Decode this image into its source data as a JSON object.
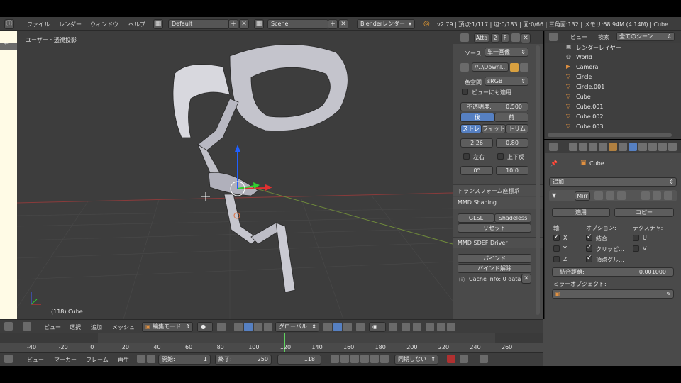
{
  "info_bar": {
    "menus": [
      "ファイル",
      "レンダー",
      "ウィンドウ",
      "ヘルプ"
    ],
    "layout": "Default",
    "scene": "Scene",
    "engine": "Blenderレンダー",
    "stats": "v2.79 | 頂点:1/117 | 辺:0/183 | 面:0/66 | 三角面:132 | メモリ:68.94M (4.14M) | Cube"
  },
  "viewport": {
    "view_label": "ユーザー・透視投影",
    "object_label": "(118) Cube"
  },
  "nprop": {
    "tabs": [
      "Atta",
      "2",
      "F"
    ],
    "source_label": "ソース",
    "source_value": "単一画像",
    "file_path": "//..\\Downl...",
    "colorspace_label": "色空間",
    "colorspace_value": "sRGB",
    "view_as_render": "ビューにも適用",
    "opacity_label": "不透明度:",
    "opacity_value": "0.500",
    "depth_back": "後",
    "depth_front": "前",
    "fit_stretch": "ストレ",
    "fit_fit": "フィット",
    "fit_crop": "トリム",
    "size_x": "2.26",
    "size_y": "0.80",
    "flip_x": "左右",
    "flip_y": "上下反",
    "rotation": "0°",
    "size": "10.0",
    "transform_panel": "トランスフォーム座標系",
    "mmd_shading": "MMD Shading",
    "glsl": "GLSL",
    "shadeless": "Shadeless",
    "reset": "リセット",
    "sdef_panel": "MMD SDEF Driver",
    "bind": "バインド",
    "unbind": "バインド解除",
    "cache_info": "Cache info: 0 data"
  },
  "outliner": {
    "view_menu": "ビュー",
    "search_menu": "検索",
    "filter": "全てのシーン",
    "items": [
      "レンダーレイヤー",
      "World",
      "Camera",
      "Circle",
      "Circle.001",
      "Cube",
      "Cube.001",
      "Cube.002",
      "Cube.003"
    ]
  },
  "properties": {
    "object_name": "Cube",
    "add_modifier": "追加",
    "modifier_name": "Mirr",
    "apply": "適用",
    "copy": "コピー",
    "axis_label": "軸:",
    "options_label": "オプション:",
    "texture_label": "テクスチャ:",
    "axis_x": "X",
    "axis_y": "Y",
    "axis_z": "Z",
    "merge": "結合",
    "clipping": "クリッピ...",
    "vertex_groups": "頂点グル...",
    "tex_u": "U",
    "tex_v": "V",
    "merge_limit_label": "結合距離:",
    "merge_limit_value": "0.001000",
    "mirror_object_label": "ミラーオブジェクト:"
  },
  "view3d_header": {
    "menus": [
      "ビュー",
      "選択",
      "追加",
      "メッシュ"
    ],
    "mode": "編集モード",
    "orientation": "グローバル"
  },
  "timeline": {
    "ticks": [
      "-40",
      "-20",
      "0",
      "20",
      "40",
      "60",
      "80",
      "100",
      "120",
      "140",
      "160",
      "180",
      "200",
      "220",
      "240",
      "260"
    ],
    "menus": [
      "ビュー",
      "マーカー",
      "フレーム",
      "再生"
    ],
    "start_label": "開始:",
    "start_value": "1",
    "end_label": "終了:",
    "end_value": "250",
    "current_frame": "118",
    "sync": "同期しない"
  },
  "colors": {
    "accent_blue": "#5680c2",
    "viewport_bg": "#3d3d3d",
    "panel_bg": "#4a4a4a",
    "playhead": "#5fd35f"
  }
}
